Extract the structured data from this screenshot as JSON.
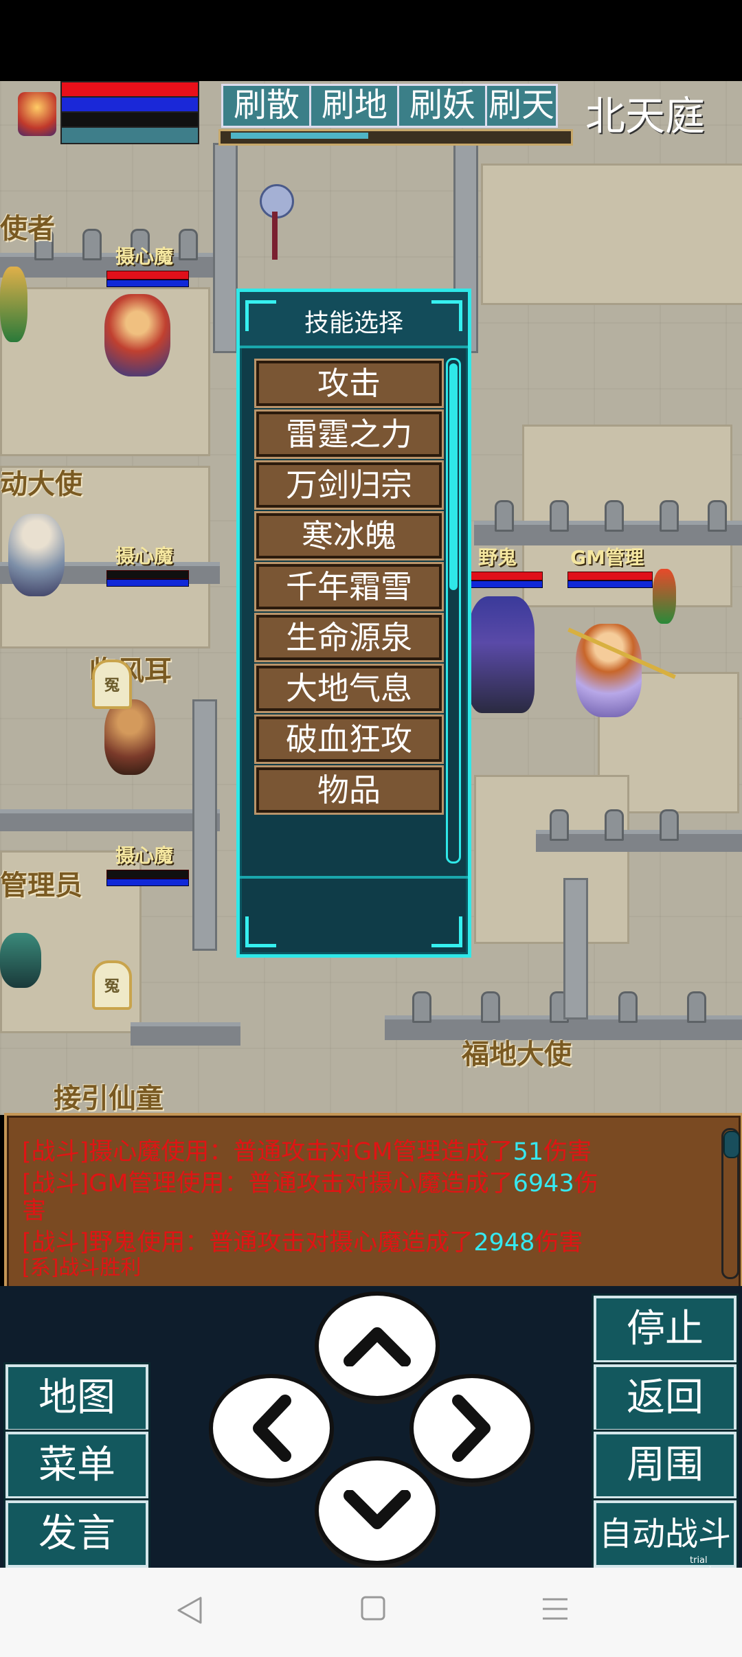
{
  "hud": {
    "tabs": [
      "刷散",
      "刷地",
      "刷妖",
      "刷天"
    ],
    "location": "北天庭"
  },
  "scene": {
    "npcs": [
      "使者",
      "动大使",
      "临风耳",
      "管理员",
      "福地大使",
      "接引仙童"
    ],
    "monsters": [
      "摄心魔",
      "摄心魔",
      "摄心魔"
    ],
    "players": [
      "野鬼",
      "GM管理"
    ],
    "tomb_glyph": "冤"
  },
  "skill_dialog": {
    "title": "技能选择",
    "items": [
      "攻击",
      "雷霆之力",
      "万剑归宗",
      "寒冰魄",
      "千年霜雪",
      "生命源泉",
      "大地气息",
      "破血狂攻",
      "物品"
    ]
  },
  "battle_log": {
    "lines": [
      {
        "prefix": "[战斗]摄心魔使用：普通攻击对GM管理造成了",
        "value": "51",
        "suffix": "伤害"
      },
      {
        "prefix": "[战斗]GM管理使用：普通攻击对摄心魔造成了",
        "value": "6943",
        "suffix": "伤"
      },
      {
        "prefix": "害",
        "value": "",
        "suffix": ""
      },
      {
        "prefix": "[战斗]野鬼使用：普通攻击对摄心魔造成了",
        "value": "2948",
        "suffix": "伤害"
      },
      {
        "prefix": "[系]战斗胜利",
        "value": "",
        "suffix": ""
      }
    ]
  },
  "controls": {
    "left": [
      "地图",
      "菜单",
      "发言"
    ],
    "right": [
      "停止",
      "返回",
      "周围",
      "自动战斗"
    ],
    "dpad": [
      "up-arrow-icon",
      "left-arrow-icon",
      "right-arrow-icon",
      "down-arrow-icon"
    ]
  },
  "watermark": "trial version",
  "colors": {
    "accent": "#2fe8e8",
    "log_text": "#e01414",
    "log_number": "#36e8f0",
    "button_bg": "#13585e"
  }
}
